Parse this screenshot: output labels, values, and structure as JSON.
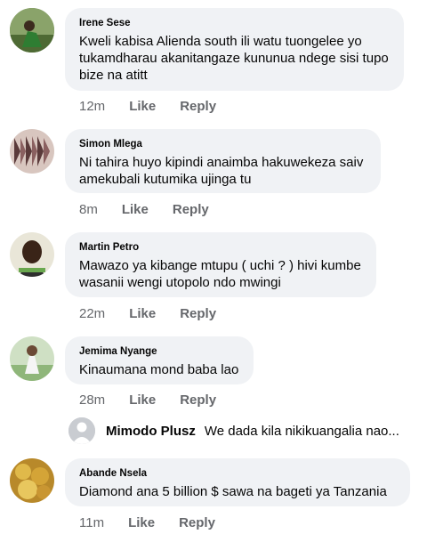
{
  "comments": [
    {
      "name": "Irene Sese",
      "text_lines": [
        "Kweli kabisa Alienda south ili watu tuongelee yo",
        "tukamdharau akanitangaze kununua ndege sisi tupo",
        "bize na atitt"
      ],
      "time": "12m",
      "like": "Like",
      "reply": "Reply"
    },
    {
      "name": "Simon Mlega",
      "text_lines": [
        "Ni tahira huyo kipindi anaimba hakuwekeza saiv",
        "amekubali kutumika ujinga tu"
      ],
      "time": "8m",
      "like": "Like",
      "reply": "Reply"
    },
    {
      "name": "Martin Petro",
      "text_lines": [
        "Mawazo ya kibange mtupu ( uchi ? ) hivi kumbe",
        "wasanii wengi utopolo ndo mwingi"
      ],
      "time": "22m",
      "like": "Like",
      "reply": "Reply"
    },
    {
      "name": "Jemima Nyange",
      "text_lines": [
        "Kinaumana mond baba lao"
      ],
      "time": "28m",
      "like": "Like",
      "reply": "Reply"
    },
    {
      "name": "Abande Nsela",
      "text_lines": [
        "Diamond ana 5 billion $  sawa na bageti ya Tanzania"
      ],
      "time": "11m",
      "like": "Like",
      "reply": "Reply"
    }
  ],
  "reply_preview": {
    "name": "Mimodo Plusz",
    "text": "We dada kila nikikuangalia nao..."
  }
}
